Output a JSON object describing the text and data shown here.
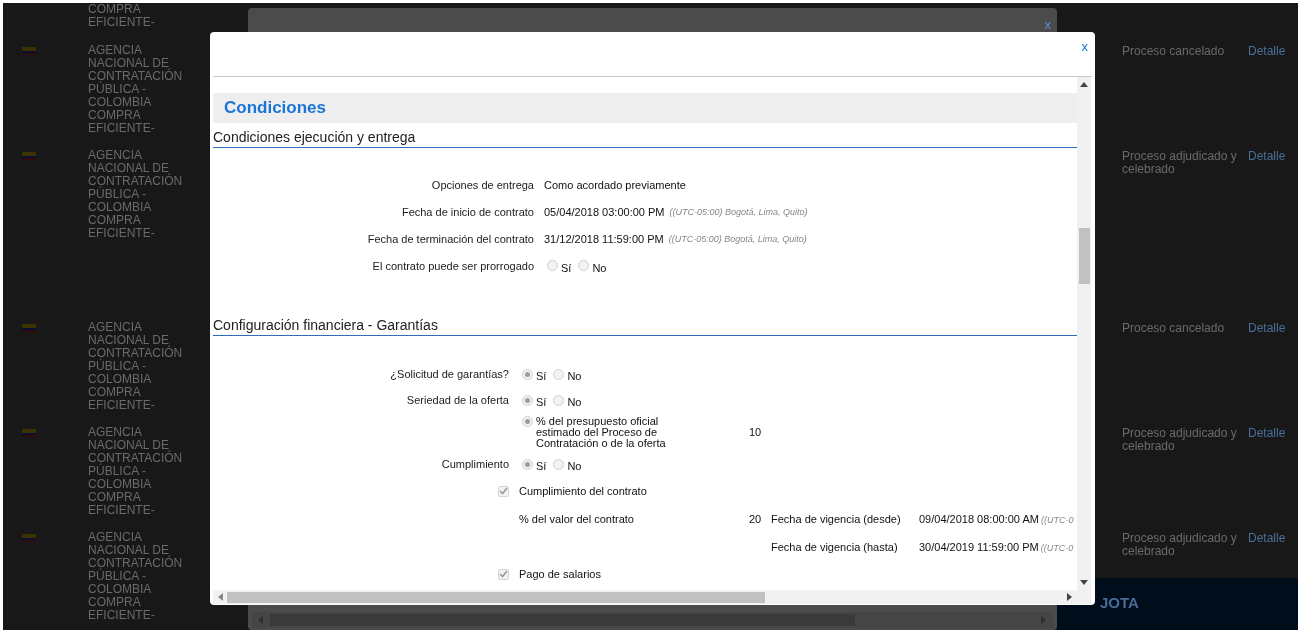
{
  "background_list": {
    "top_fragment": "COMPRA EFICIENTE-",
    "rows": [
      {
        "agency": "AGENCIA NACIONAL DE CONTRATACIÓN PÚBLICA - COLOMBIA COMPRA EFICIENTE-",
        "status": "Proceso cancelado",
        "link": "Detalle"
      },
      {
        "agency": "AGENCIA NACIONAL DE CONTRATACIÓN PÚBLICA - COLOMBIA COMPRA EFICIENTE-",
        "status": "Proceso adjudicado y celebrado",
        "link": "Detalle"
      },
      {
        "agency": "AGENCIA NACIONAL DE CONTRATACIÓN PÚBLICA - COLOMBIA COMPRA EFICIENTE-",
        "status": "Proceso cancelado",
        "link": "Detalle"
      },
      {
        "agency": "AGENCIA NACIONAL DE CONTRATACIÓN PÚBLICA - COLOMBIA COMPRA EFICIENTE-",
        "status": "Proceso adjudicado y celebrado",
        "link": "Detalle"
      },
      {
        "agency": "AGENCIA NACIONAL DE CONTRATACIÓN PÚBLICA - COLOMBIA COMPRA EFICIENTE-",
        "status": "Proceso adjudicado y celebrado",
        "link": "Detalle"
      }
    ]
  },
  "back_dialog": {
    "close": "x"
  },
  "promo_panel": {
    "title": "JOTA"
  },
  "modal": {
    "close": "x",
    "heading": "Condiciones",
    "sections": [
      {
        "title": "Condiciones ejecución y entrega",
        "fields": [
          {
            "kind": "text",
            "label": "Opciones de entrega",
            "value": "Como acordado previamente"
          },
          {
            "kind": "text",
            "label": "Fecha de inicio de contrato",
            "value": "05/04/2018 03:00:00 PM",
            "timezone": "((UTC-05:00) Bogotá, Lima, Quito)"
          },
          {
            "kind": "text",
            "label": "Fecha de terminación del contrato",
            "value": "31/12/2018 11:59:00 PM",
            "timezone": "((UTC-05:00) Bogotá, Lima, Quito)"
          },
          {
            "kind": "radio",
            "label": "El contrato puede ser prorrogado",
            "options": [
              {
                "label": "Sí",
                "selected": false
              },
              {
                "label": "No",
                "selected": false
              }
            ]
          }
        ]
      },
      {
        "title": "Configuración financiera - Garantías",
        "fields": [
          {
            "kind": "radio",
            "label": "¿Solicitud de garantías?",
            "options": [
              {
                "label": "Sí",
                "selected": true
              },
              {
                "label": "No",
                "selected": false
              }
            ]
          },
          {
            "kind": "radio",
            "label": "Seriedad de la oferta",
            "options": [
              {
                "label": "Sí",
                "selected": true
              },
              {
                "label": "No",
                "selected": false
              }
            ]
          },
          {
            "kind": "option_value",
            "option": {
              "label": "% del presupuesto oficial estimado del Proceso de Contratación o de la oferta",
              "selected": true
            },
            "value": "10"
          },
          {
            "kind": "radio",
            "label": "Cumplimiento",
            "options": [
              {
                "label": "Sí",
                "selected": true
              },
              {
                "label": "No",
                "selected": false
              }
            ]
          },
          {
            "kind": "checkbox",
            "label": "Cumplimiento del contrato",
            "checked": true
          },
          {
            "kind": "percent",
            "label": "% del valor del contrato",
            "value": "20",
            "date_label": "Fecha de vigencia (desde)",
            "date": "09/04/2018 08:00:00 AM",
            "timezone": "((UTC-0"
          },
          {
            "kind": "date",
            "date_label": "Fecha de vigencia (hasta)",
            "date": "30/04/2019 11:59:00 PM",
            "timezone": "((UTC-0"
          },
          {
            "kind": "checkbox",
            "label": "Pago de salarios",
            "checked": true
          }
        ]
      }
    ]
  }
}
